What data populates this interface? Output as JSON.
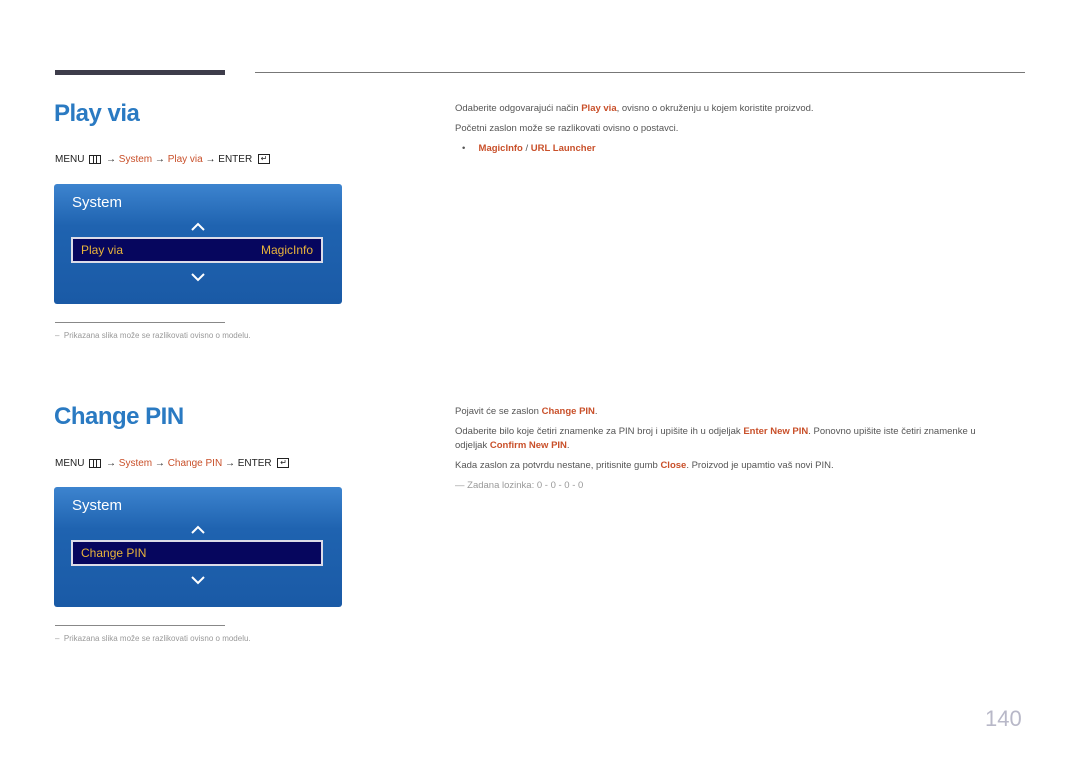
{
  "sections": [
    {
      "title": "Play via",
      "breadcrumb": {
        "menu": "MENU",
        "arrow": "→",
        "system": "System",
        "item": "Play via",
        "enter": "ENTER"
      },
      "osd": {
        "title": "System",
        "row_label": "Play via",
        "row_value": "MagicInfo"
      },
      "footnote": "Prikazana slika može se razlikovati ovisno o modelu.",
      "description": {
        "line1_pre": "Odaberite odgovarajući način ",
        "line1_bold": "Play via",
        "line1_post": ", ovisno o okruženju u kojem koristite proizvod.",
        "line2": "Početni zaslon može se razlikovati ovisno o postavci.",
        "bullet_a": "MagicInfo",
        "bullet_sep": " / ",
        "bullet_b": "URL Launcher"
      }
    },
    {
      "title": "Change PIN",
      "breadcrumb": {
        "menu": "MENU",
        "arrow": "→",
        "system": "System",
        "item": "Change PIN",
        "enter": "ENTER"
      },
      "osd": {
        "title": "System",
        "row_label": "Change PIN",
        "row_value": ""
      },
      "footnote": "Prikazana slika može se razlikovati ovisno o modelu.",
      "description": {
        "p1_pre": "Pojavit će se zaslon ",
        "p1_bold": "Change PIN",
        "p1_post": ".",
        "p2_pre": "Odaberite bilo koje četiri znamenke za PIN broj i upišite ih u odjeljak ",
        "p2_bold1": "Enter New PIN",
        "p2_mid": ". Ponovno upišite iste četiri znamenke u",
        "p2_line2_pre": "odjeljak ",
        "p2_bold2": "Confirm New PIN",
        "p2_post": ".",
        "p3_pre": "Kada zaslon za potvrdu nestane, pritisnite gumb ",
        "p3_bold": "Close",
        "p3_post": ". Proizvod je upamtio vaš novi PIN.",
        "note": "Zadana lozinka: 0 - 0 - 0 - 0"
      }
    }
  ],
  "page_number": "140"
}
